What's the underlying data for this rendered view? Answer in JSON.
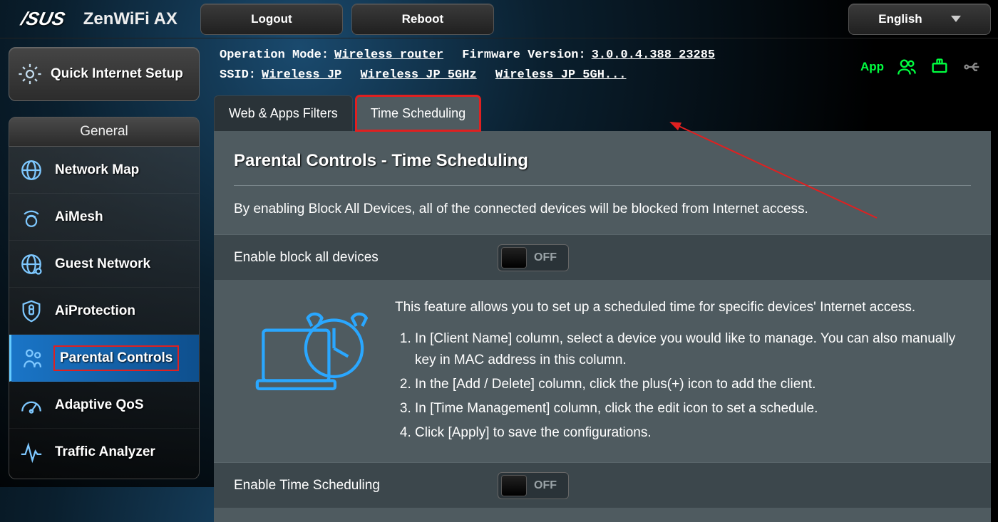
{
  "brand": "/SUS",
  "model": "ZenWiFi AX",
  "topButtons": {
    "logout": "Logout",
    "reboot": "Reboot"
  },
  "language": "English",
  "info": {
    "opModeLabel": "Operation Mode:",
    "opMode": "Wireless router",
    "fwLabel": "Firmware Version:",
    "fw": "3.0.0.4.388_23285",
    "ssidLabel": "SSID:",
    "ssid1": "Wireless JP",
    "ssid2": "Wireless JP 5GHz",
    "ssid3": "Wireless JP 5GH..."
  },
  "appLink": "App",
  "qis": "Quick Internet Setup",
  "sectionGeneral": "General",
  "nav": {
    "networkMap": "Network Map",
    "aimesh": "AiMesh",
    "guest": "Guest Network",
    "aiprotection": "AiProtection",
    "parental": "Parental Controls",
    "qos": "Adaptive QoS",
    "traffic": "Traffic Analyzer"
  },
  "tabs": {
    "filters": "Web & Apps Filters",
    "time": "Time Scheduling"
  },
  "panel": {
    "title": "Parental Controls - Time Scheduling",
    "desc": "By enabling Block All Devices, all of the connected devices will be blocked from Internet access.",
    "blockAllLabel": "Enable block all devices",
    "blockAllState": "OFF",
    "featureIntro": "This feature allows you to set up a scheduled time for specific devices' Internet access.",
    "step1": "In [Client Name] column, select a device you would like to manage. You can also manually key in MAC address in this column.",
    "step2": "In the [Add / Delete] column, click the plus(+) icon to add the client.",
    "step3": "In [Time Management] column, click the edit icon to set a schedule.",
    "step4": "Click [Apply] to save the configurations.",
    "timeSchedLabel": "Enable Time Scheduling",
    "timeSchedState": "OFF"
  }
}
